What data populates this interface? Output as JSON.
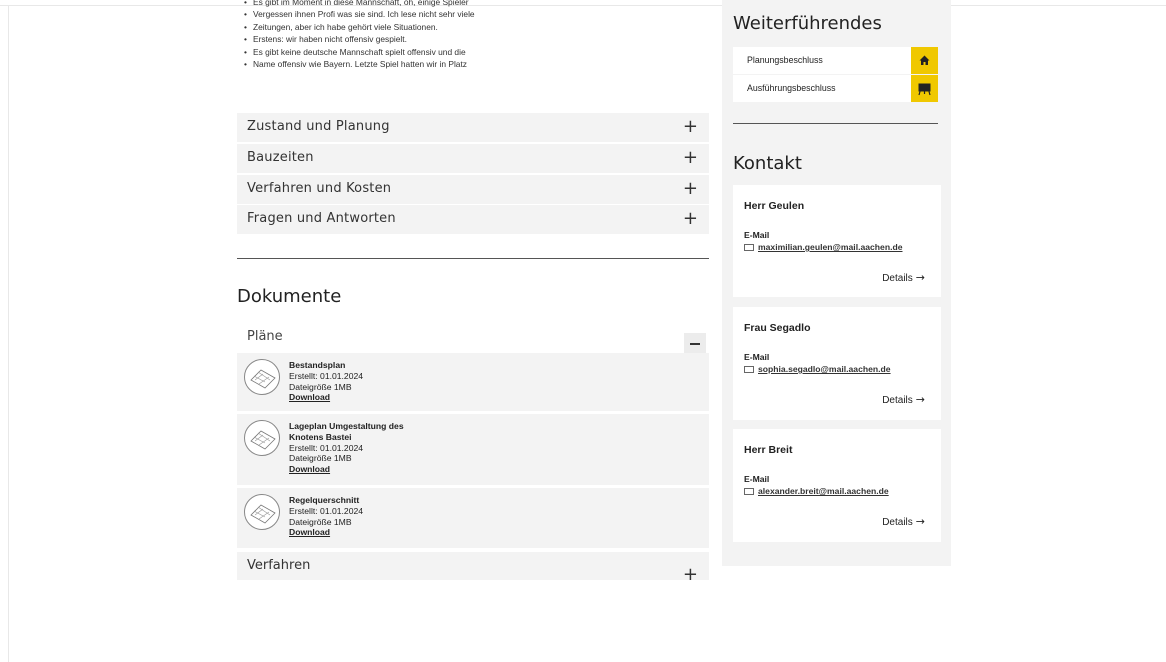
{
  "intro_bullets": [
    "Es gibt im Moment in diese Mannschaft, oh, einige Spieler",
    "Vergessen ihnen Profi was sie sind. Ich lese nicht sehr viele",
    "Zeitungen, aber ich habe gehört viele Situationen.",
    "Erstens: wir haben nicht offensiv gespielt.",
    "Es gibt keine deutsche Mannschaft spielt offensiv und die",
    "Name offensiv wie Bayern. Letzte Spiel hatten wir in Platz"
  ],
  "accordion": [
    {
      "label": "Zustand und Planung",
      "toggle": "+"
    },
    {
      "label": "Bauzeiten",
      "toggle": "+"
    },
    {
      "label": "Verfahren und Kosten",
      "toggle": "+"
    },
    {
      "label": "Fragen und Antworten",
      "toggle": "+"
    }
  ],
  "documents": {
    "heading": "Dokumente",
    "group_open": {
      "label": "Pläne"
    },
    "items": [
      {
        "title": "Bestandsplan",
        "created": "Erstellt: 01.01.2024",
        "size": "Dateigröße 1MB",
        "download": "Download"
      },
      {
        "title": "Lageplan Umgestaltung des Knotens Bastei",
        "created": "Erstellt: 01.01.2024",
        "size": "Dateigröße 1MB",
        "download": "Download"
      },
      {
        "title": "Regelquerschnitt",
        "created": "Erstellt: 01.01.2024",
        "size": "Dateigröße 1MB",
        "download": "Download"
      }
    ],
    "group_closed": {
      "label": "Verfahren",
      "toggle": "+"
    }
  },
  "sidebar": {
    "further_heading": "Weiterführendes",
    "links": [
      {
        "label": "Planungsbeschluss",
        "icon": "home-icon"
      },
      {
        "label": "Ausführungsbeschluss",
        "icon": "presentation-icon"
      }
    ],
    "contact_heading": "Kontakt",
    "contacts": [
      {
        "name": "Herr Geulen",
        "email_label": "E-Mail",
        "email": "maximilian.geulen@mail.aachen.de",
        "details": "Details",
        "arrow": "→"
      },
      {
        "name": "Frau Segadlo",
        "email_label": "E-Mail",
        "email": "sophia.segadlo@mail.aachen.de",
        "details": "Details",
        "arrow": "→"
      },
      {
        "name": "Herr Breit",
        "email_label": "E-Mail",
        "email": "alexander.breit@mail.aachen.de",
        "details": "Details",
        "arrow": "→"
      }
    ]
  },
  "colors": {
    "accent": "#f0c800",
    "panel": "#f3f3f3",
    "text": "#222222"
  }
}
